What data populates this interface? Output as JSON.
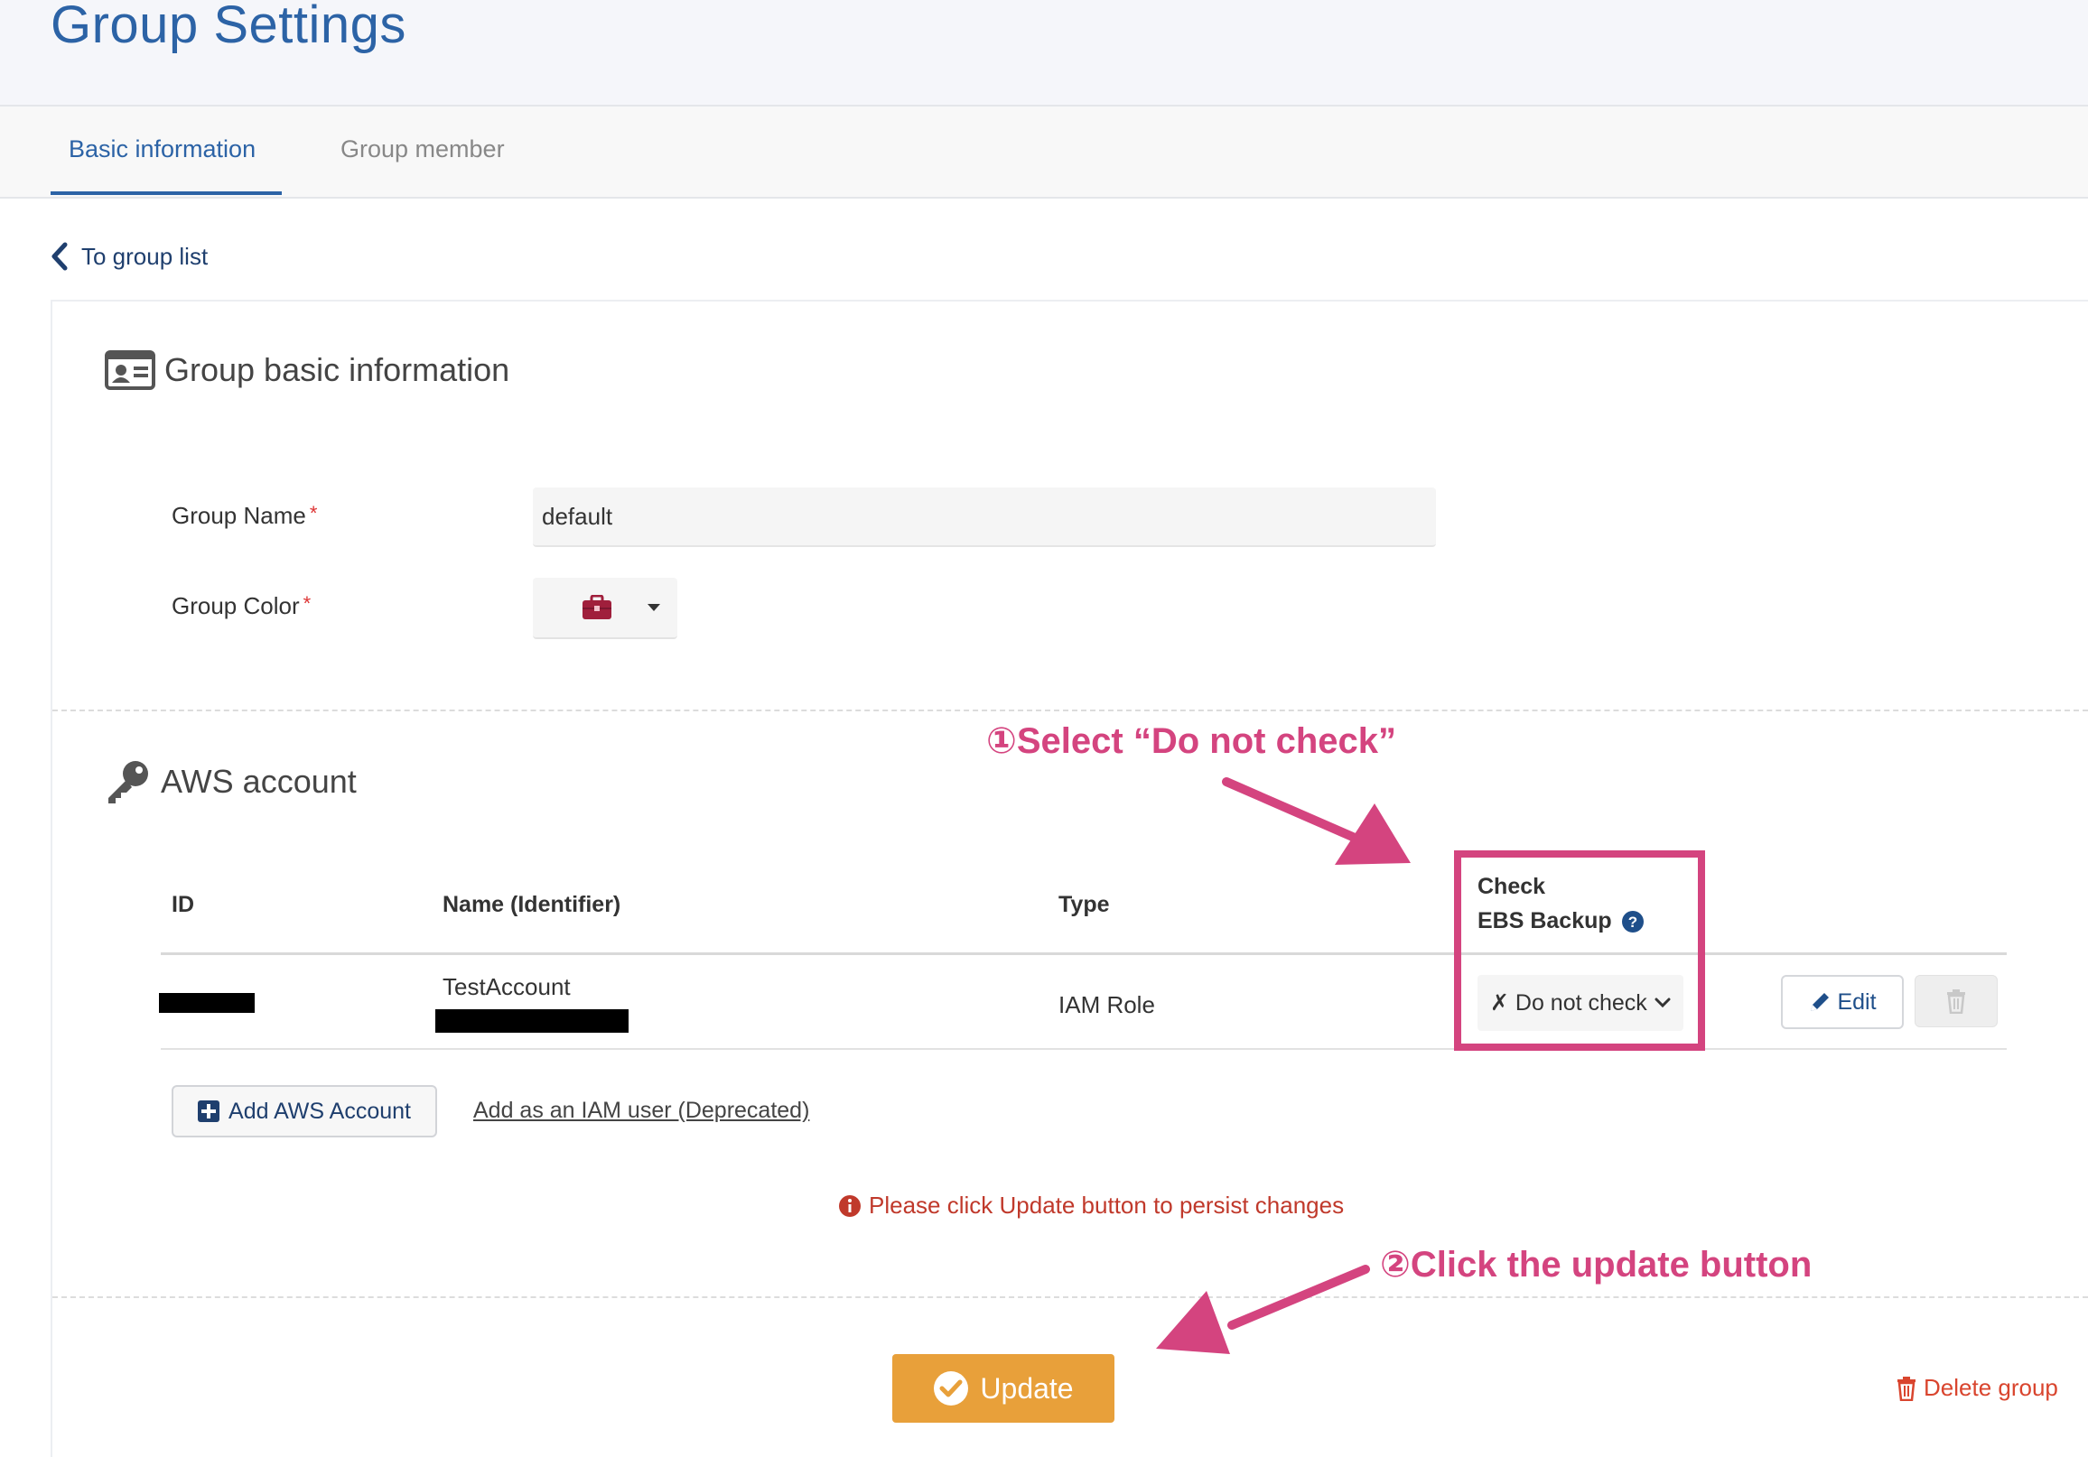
{
  "header": {
    "title": "Group Settings"
  },
  "tabs": [
    {
      "label": "Basic information",
      "active": true
    },
    {
      "label": "Group member",
      "active": false
    }
  ],
  "back_link": "To group list",
  "basic_section": {
    "title": "Group basic information",
    "group_name_label": "Group Name",
    "group_name_value": "default",
    "group_color_label": "Group Color",
    "required_mark": "*"
  },
  "aws_section": {
    "title": "AWS account",
    "columns": {
      "id": "ID",
      "name": "Name (Identifier)",
      "type": "Type",
      "check_line1": "Check",
      "check_line2": "EBS Backup"
    },
    "rows": [
      {
        "name": "TestAccount",
        "type": "IAM Role",
        "check_value": "✗ Do not check",
        "edit_label": "Edit"
      }
    ],
    "add_button": "Add AWS Account",
    "iam_link": "Add as an IAM user (Deprecated)",
    "notice": "Please click Update button to persist changes"
  },
  "footer": {
    "update_label": "Update",
    "delete_label": "Delete group"
  },
  "annotations": {
    "step1": "①Select “Do not check”",
    "step2": "②Click the update button"
  },
  "colors": {
    "primary": "#2c63a6",
    "annotation": "#d4447f",
    "update": "#e8a03a",
    "danger": "#d9452e",
    "group_color_icon": "#a01f3c"
  }
}
